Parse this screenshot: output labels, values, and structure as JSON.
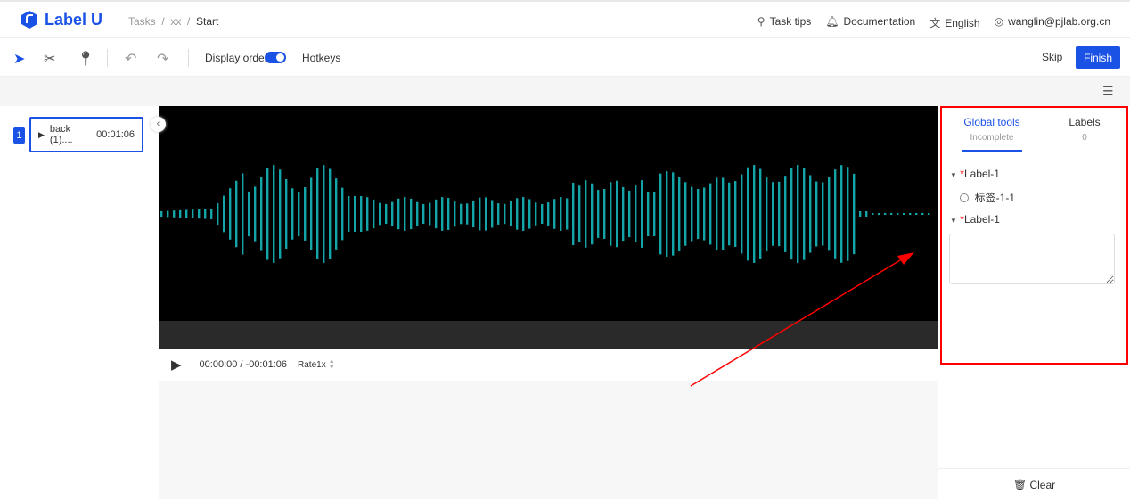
{
  "header": {
    "logo": "Label U",
    "breadcrumb": [
      "Tasks",
      "xx",
      "Start"
    ],
    "links": [
      {
        "icon": "bulb-icon",
        "label": "Task tips"
      },
      {
        "icon": "bell-icon",
        "label": "Documentation"
      },
      {
        "icon": "translate-icon",
        "label": "English"
      },
      {
        "icon": "user-icon",
        "label": "wanglin@pjlab.org.cn"
      }
    ]
  },
  "toolbar": {
    "display_order": "Display order",
    "display_order_on": true,
    "hotkeys": "Hotkeys",
    "skip": "Skip",
    "finish": "Finish"
  },
  "files": [
    {
      "index": "1",
      "name": "back (1)....",
      "duration": "00:01:06"
    }
  ],
  "player": {
    "time": "00:00:00 / -00:01:06",
    "rate": "Rate1x"
  },
  "panel": {
    "tabs": [
      {
        "label": "Global tools",
        "sub": "Incomplete",
        "active": true
      },
      {
        "label": "Labels",
        "sub": "0"
      }
    ],
    "groups": [
      {
        "label": "Label-1",
        "required": true,
        "options": [
          "标签-1-1"
        ]
      },
      {
        "label": "Label-1",
        "required": true,
        "textarea": ""
      }
    ],
    "clear": "Clear"
  },
  "colors": {
    "accent": "#1b52e6",
    "wave": "#14a5a9",
    "annotation": "#ff0000"
  }
}
